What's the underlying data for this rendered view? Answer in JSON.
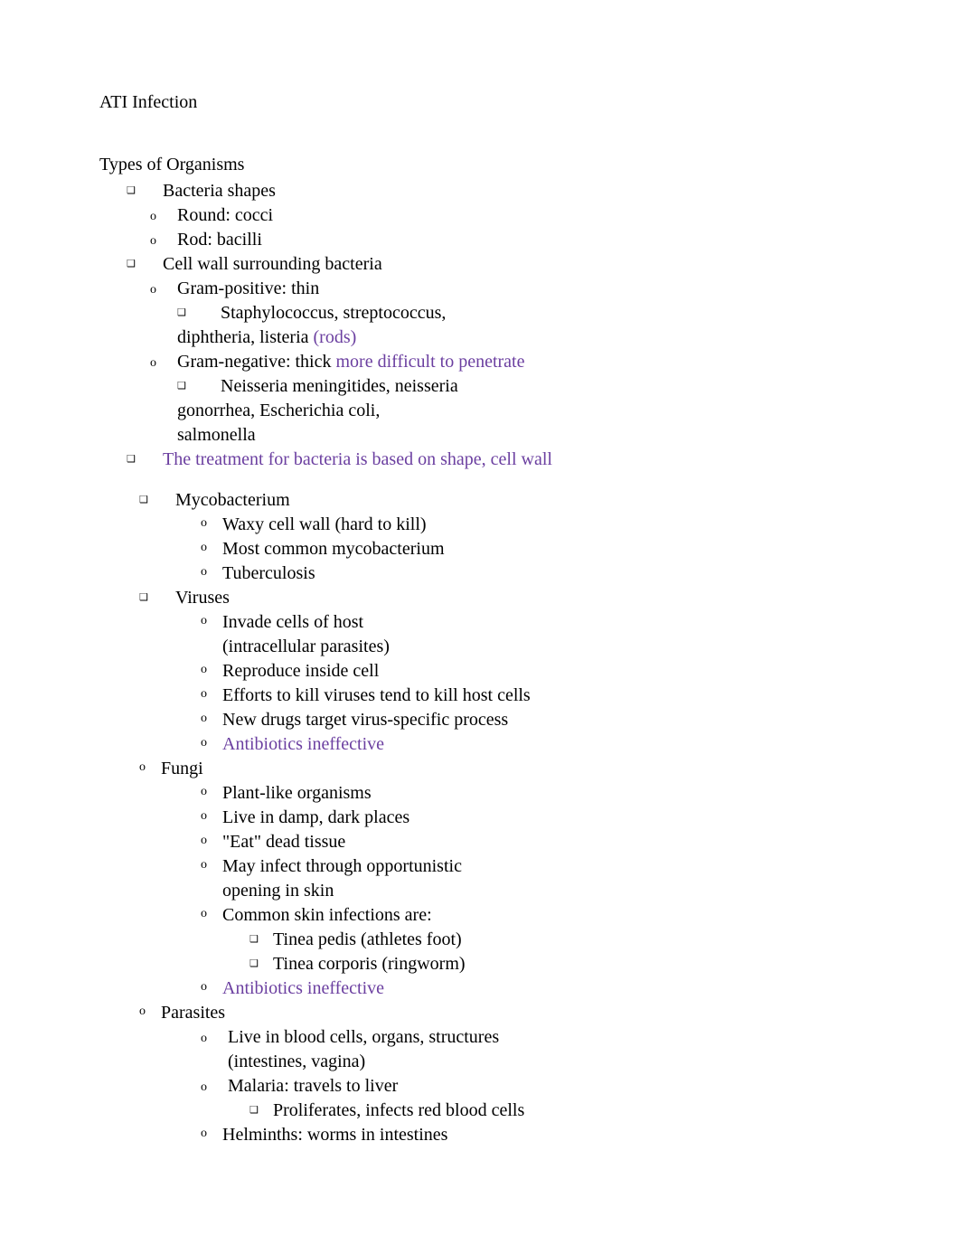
{
  "title": "ATI Infection",
  "section_heading": "Types of Organisms",
  "items": {
    "bacteria_shapes": "Bacteria shapes",
    "round_cocci": "Round: cocci",
    "rod_bacilli": "Rod: bacilli",
    "cell_wall": "Cell wall surrounding bacteria",
    "gram_pos": "Gram-positive: thin",
    "gram_pos_ex1": "Staphylococcus, streptococcus,",
    "gram_pos_ex2_a": "diphtheria, listeria",
    "gram_pos_ex2_b": "(rods)",
    "gram_neg_a": "Gram-negative: thick",
    "gram_neg_b": "more difficult to penetrate",
    "gram_neg_ex1": "Neisseria meningitides, neisseria",
    "gram_neg_ex2": "gonorrhea, Escherichia coli,",
    "gram_neg_ex3": "salmonella",
    "treatment_note": "The treatment for bacteria is based on shape, cell wall",
    "mycobacterium": "Mycobacterium",
    "myco_1": "Waxy cell wall (hard to kill)",
    "myco_2": "Most common mycobacterium",
    "myco_3": "Tuberculosis",
    "viruses": "Viruses",
    "virus_1a": "Invade cells of host",
    "virus_1b": "(intracellular parasites)",
    "virus_2": "Reproduce inside cell",
    "virus_3": "Efforts to kill viruses tend to kill host cells",
    "virus_4": "New drugs target virus-specific process",
    "virus_5": "Antibiotics ineffective",
    "fungi": "Fungi",
    "fungi_1": "Plant-like organisms",
    "fungi_2": "Live in damp, dark places",
    "fungi_3": "\"Eat\" dead tissue",
    "fungi_4a": "May infect through opportunistic",
    "fungi_4b": "opening in skin",
    "fungi_5": "Common skin infections are:",
    "fungi_5a": "Tinea pedis (athletes foot)",
    "fungi_5b": "Tinea corporis (ringworm)",
    "fungi_6": "Antibiotics ineffective",
    "parasites": "Parasites",
    "para_1a": "Live in blood cells, organs, structures",
    "para_1b": "(intestines, vagina)",
    "para_2": "Malaria: travels to liver",
    "para_2a": "Proliferates, infects red blood cells",
    "para_3": "Helminths: worms in intestines"
  }
}
